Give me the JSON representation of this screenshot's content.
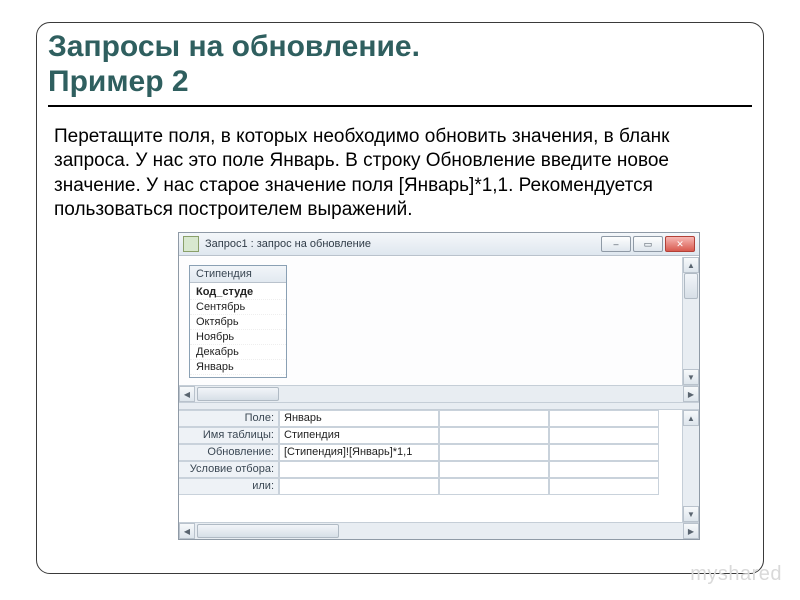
{
  "title_line1": "Запросы на обновление.",
  "title_line2": "Пример 2",
  "body_text": "Перетащите поля, в которых необходимо обновить значения, в бланк запроса. У нас это поле Январь. В строку Обновление введите новое значение. У нас старое значение поля [Январь]*1,1. Рекомендуется пользоваться построителем выражений.",
  "window": {
    "title": "Запрос1 : запрос на обновление",
    "min": "–",
    "max": "▭",
    "close": "✕",
    "table_title": "Стипендия",
    "fields": [
      "Код_студе",
      "Сентябрь",
      "Октябрь",
      "Ноябрь",
      "Декабрь",
      "Январь"
    ],
    "grid_labels": [
      "Поле:",
      "Имя таблицы:",
      "Обновление:",
      "Условие отбора:",
      "или:"
    ],
    "grid_col1": [
      "Январь",
      "Стипендия",
      "[Стипендия]![Январь]*1,1",
      "",
      ""
    ]
  },
  "watermark": "myshared"
}
